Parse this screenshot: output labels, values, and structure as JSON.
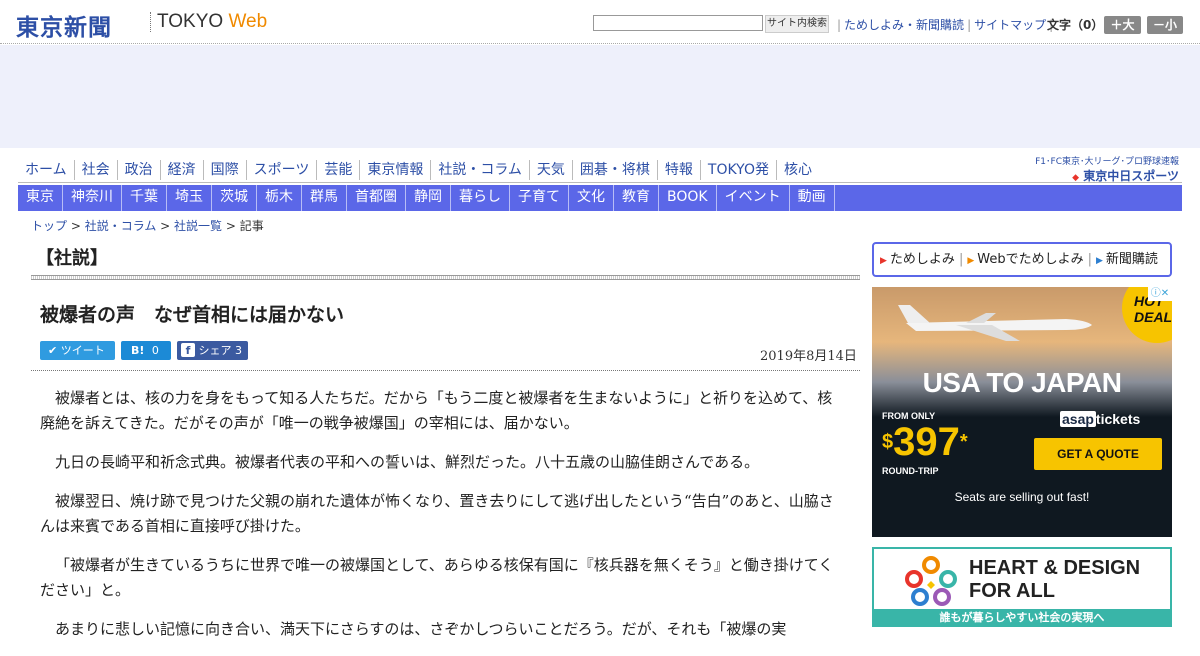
{
  "header": {
    "logo": "東京新聞",
    "logo_tokyo": "TOKYO ",
    "logo_web": "Web",
    "search_button": "サイト内検索",
    "links": [
      "ためしよみ・新聞購読",
      "サイトマップ"
    ],
    "font_size_label": "文字（0）",
    "font_larger": "＋大",
    "font_smaller": "－小"
  },
  "nav_primary": [
    "ホーム",
    "社会",
    "政治",
    "経済",
    "国際",
    "スポーツ",
    "芸能",
    "東京情報",
    "社説・コラム",
    "天気",
    "囲碁・将棋",
    "特報",
    "TOKYO発",
    "核心"
  ],
  "chunichi": {
    "tagline": "F1･FC東京･大リーグ･プロ野球速報",
    "name": "東京中日スポーツ"
  },
  "nav_regional": [
    "東京",
    "神奈川",
    "千葉",
    "埼玉",
    "茨城",
    "栃木",
    "群馬",
    "首都圏",
    "静岡",
    "暮らし",
    "子育て",
    "文化",
    "教育",
    "BOOK",
    "イベント",
    "動画"
  ],
  "breadcrumb": {
    "items": [
      "トップ",
      "社説・コラム",
      "社説一覧"
    ],
    "sep": " > ",
    "current": "記事"
  },
  "article": {
    "section": "【社説】",
    "headline": "被爆者の声　なぜ首相には届かない",
    "date": "2019年8月14日",
    "share": {
      "tweet": "ツイート",
      "hatena_count": "0",
      "facebook": "シェア",
      "facebook_count": "3"
    },
    "paragraphs": [
      "被爆者とは、核の力を身をもって知る人たちだ。だから「もう二度と被爆者を生まないように」と祈りを込めて、核廃絶を訴えてきた。だがその声が「唯一の戦争被爆国」の宰相には、届かない。",
      "九日の長崎平和祈念式典。被爆者代表の平和への誓いは、鮮烈だった。八十五歳の山脇佳朗さんである。",
      "被爆翌日、焼け跡で見つけた父親の崩れた遺体が怖くなり、置き去りにして逃げ出したという“告白”のあと、山脇さんは来賓である首相に直接呼び掛けた。",
      "「被爆者が生きているうちに世界で唯一の被爆国として、あらゆる核保有国に『核兵器を無くそう』と働き掛けてください」と。",
      "あまりに悲しい記憶に向き合い、満天下にさらすのは、さぞかしつらいことだろう。だが、それも「被爆の実"
    ]
  },
  "sidebar": {
    "links": [
      "ためしよみ",
      "Webでためしよみ",
      "新聞購読"
    ],
    "link_colors": [
      "#e8342b",
      "#f08a00",
      "#2d7fd0"
    ]
  },
  "ad_travel": {
    "badge": "HOT DEAL",
    "close": "ⓘ✕",
    "headline": "USA TO JAPAN",
    "from_label": "FROM ONLY",
    "price": "397",
    "currency": "$",
    "asterisk": "*",
    "round_trip": "ROUND-TRIP",
    "brand_a": "asap",
    "brand_b": "tickets",
    "cta": "GET A QUOTE",
    "footnote": "Seats are selling out fast!"
  },
  "ad_heart": {
    "title_line1": "HEART & DESIGN",
    "title_line2": "FOR ALL",
    "strip": "誰もが暮らしやすい社会の実現へ"
  }
}
